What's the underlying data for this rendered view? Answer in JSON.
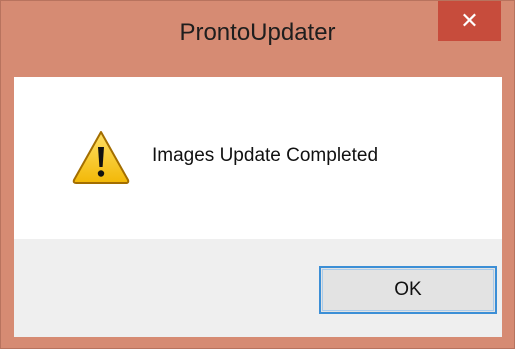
{
  "window": {
    "title": "ProntoUpdater",
    "close_glyph": "✕"
  },
  "dialog": {
    "icon": "warning-icon",
    "message": "Images Update Completed",
    "ok_label": "OK"
  },
  "colors": {
    "frame": "#d68b73",
    "close_button": "#c74c3c",
    "footer": "#efefef",
    "focus_border": "#3c8fd6"
  }
}
